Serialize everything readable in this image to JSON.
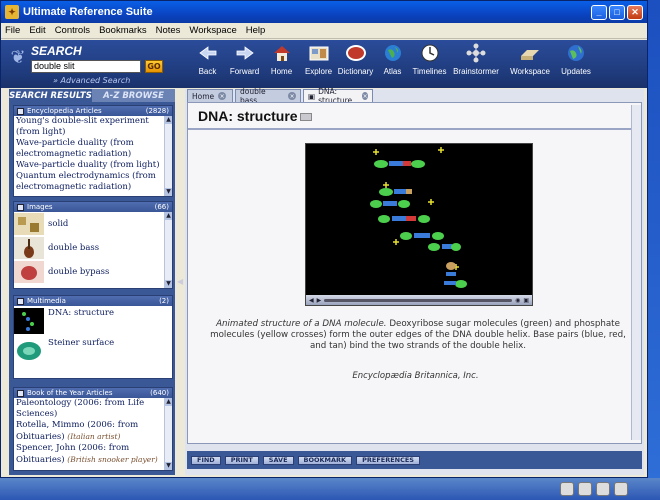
{
  "window": {
    "title": "Ultimate Reference Suite"
  },
  "menu": [
    "File",
    "Edit",
    "Controls",
    "Bookmarks",
    "Notes",
    "Workspace",
    "Help"
  ],
  "search": {
    "title": "SEARCH",
    "query": "double slit",
    "go_label": "GO",
    "advanced_label": "» Advanced Search"
  },
  "toolbar": [
    {
      "label": "Back",
      "icon": "back-arrow-icon"
    },
    {
      "label": "Forward",
      "icon": "forward-arrow-icon"
    },
    {
      "label": "Home",
      "icon": "home-icon"
    },
    {
      "label": "Explore",
      "icon": "explore-icon"
    },
    {
      "label": "Dictionary",
      "icon": "dictionary-icon"
    },
    {
      "label": "Atlas",
      "icon": "globe-icon"
    },
    {
      "label": "Timelines",
      "icon": "clock-icon"
    },
    {
      "label": "Brainstormer",
      "icon": "brainstormer-icon"
    },
    {
      "label": "Workspace",
      "icon": "workspace-icon"
    },
    {
      "label": "Updates",
      "icon": "updates-globe-icon"
    }
  ],
  "sidebar": {
    "tabs": [
      "SEARCH RESULTS",
      "A-Z BROWSE"
    ],
    "encyclopedia": {
      "heading": "Encyclopedia Articles",
      "count": "(2828)",
      "items": [
        "Young's double-slit experiment (from light)",
        "Wave-particle duality (from electromagnetic radiation)",
        "Wave-particle duality (from light)",
        "Quantum electrodynamics (from electromagnetic radiation)"
      ]
    },
    "images": {
      "heading": "Images",
      "count": "(66)",
      "items": [
        "solid",
        "double bass",
        "double bypass"
      ]
    },
    "multimedia": {
      "heading": "Multimedia",
      "count": "(2)",
      "items": [
        "DNA: structure",
        "Steiner surface"
      ]
    },
    "book_of_year": {
      "heading": "Book of the Year Articles",
      "count": "(640)",
      "items": [
        {
          "text": "Paleontology (2006: from Life Sciences)",
          "sub": ""
        },
        {
          "text": "Rotella, Mimmo (2006: from Obituaries)",
          "sub": "(Italian artist)"
        },
        {
          "text": "Spencer, John (2006: from Obituaries)",
          "sub": "(British snooker player)"
        }
      ]
    }
  },
  "main": {
    "tabs": [
      "Home",
      "double bass",
      "DNA: structure"
    ],
    "title": "DNA: structure",
    "caption_italic": "Animated structure of a DNA molecule.",
    "caption": "Deoxyribose sugar molecules (green) and phosphate molecules (yellow crosses) form the outer edges of the DNA double helix. Base pairs (blue, red, and tan) bind the two strands of the double helix.",
    "credit": "Encyclopædia Britannica, Inc.",
    "actions": [
      "FIND",
      "PRINT",
      "SAVE",
      "BOOKMARK",
      "PREFERENCES"
    ]
  }
}
